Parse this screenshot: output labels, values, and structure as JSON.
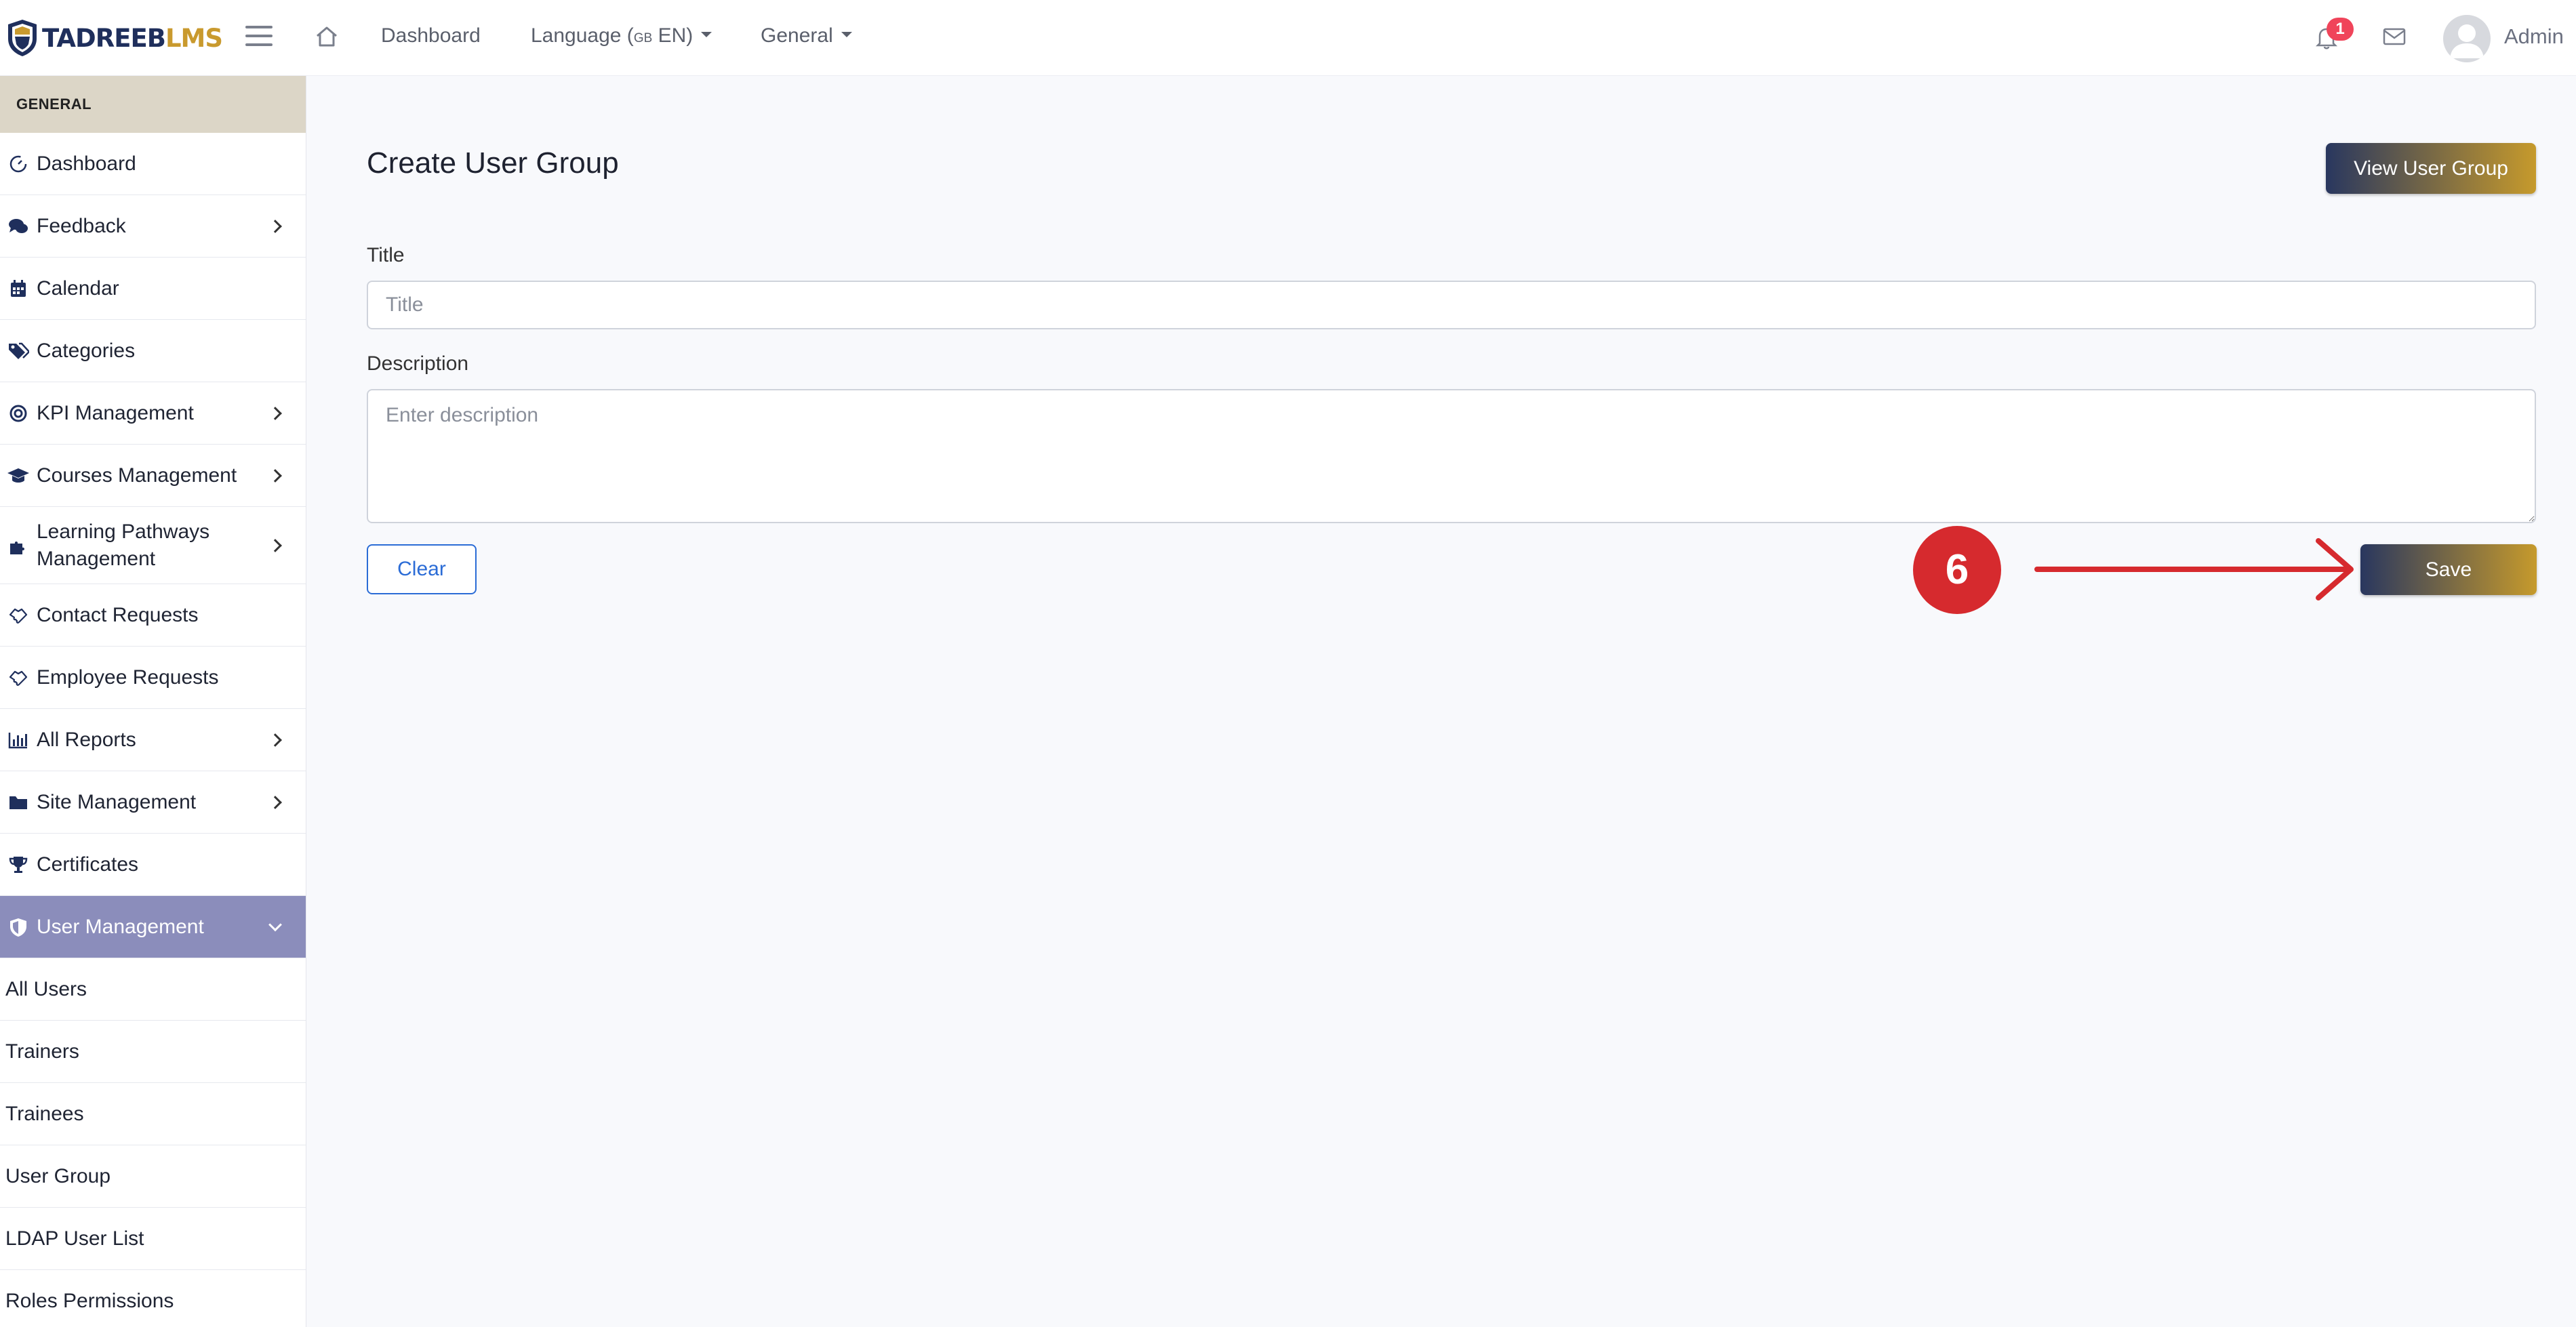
{
  "brand": {
    "part1": "TADREEB",
    "part2": "LMS",
    "primary_color": "#1f2f5c",
    "accent_color": "#c99a2e"
  },
  "topbar": {
    "dashboard_link": "Dashboard",
    "language_label": "Language (",
    "language_flag": "GB",
    "language_code": " EN)",
    "general_menu": "General",
    "notification_count": "1",
    "user_name": "Admin"
  },
  "sidebar": {
    "section_title": "GENERAL",
    "items": [
      {
        "label": "Dashboard",
        "icon": "gauge-icon"
      },
      {
        "label": "Feedback",
        "icon": "comments-icon",
        "has_children": true
      },
      {
        "label": "Calendar",
        "icon": "calendar-icon"
      },
      {
        "label": "Categories",
        "icon": "tags-icon"
      },
      {
        "label": "KPI Management",
        "icon": "target-icon",
        "has_children": true
      },
      {
        "label": "Courses Management",
        "icon": "graduation-cap-icon",
        "has_children": true
      },
      {
        "label": "Learning Pathways Management",
        "icon": "puzzle-icon",
        "has_children": true
      },
      {
        "label": "Contact Requests",
        "icon": "handshake-icon"
      },
      {
        "label": "Employee Requests",
        "icon": "handshake-icon"
      },
      {
        "label": "All Reports",
        "icon": "bar-chart-icon",
        "has_children": true
      },
      {
        "label": "Site Management",
        "icon": "folder-icon",
        "has_children": true
      },
      {
        "label": "Certificates",
        "icon": "trophy-icon"
      },
      {
        "label": "User Management",
        "icon": "shield-icon",
        "has_children": true,
        "active": true,
        "active_color": "#8b8dbb"
      }
    ],
    "sub_items": [
      "All Users",
      "Trainers",
      "Trainees",
      "User Group",
      "LDAP User List",
      "Roles Permissions"
    ]
  },
  "main": {
    "page_title": "Create User Group",
    "view_button": "View User Group",
    "title_label": "Title",
    "title_placeholder": "Title",
    "title_value": "",
    "description_label": "Description",
    "description_placeholder": "Enter description",
    "description_value": "",
    "clear_button": "Clear",
    "save_button": "Save"
  },
  "annotation": {
    "step_number": "6",
    "color": "#d62a2e"
  }
}
